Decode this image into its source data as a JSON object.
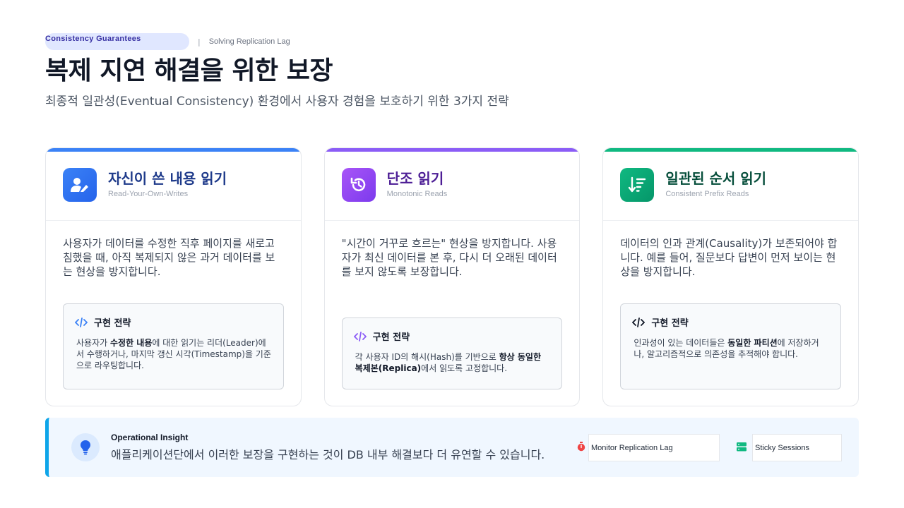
{
  "header": {
    "badge": "Consistency Guarantees",
    "separator": "|",
    "section": "Solving Replication Lag",
    "title": "복제 지연 해결을 위한 보장",
    "subtitle": "최종적 일관성(Eventual Consistency) 환경에서 사용자 경험을 보호하기 위한 3가지 전략"
  },
  "cards": [
    {
      "title": "자신이 쓴 내용 읽기",
      "subtitle_en": "Read-Your-Own-Writes",
      "icon": "user-edit-icon",
      "accent": "#3b82f6",
      "title_color": "#1e3a8a",
      "description": "사용자가 데이터를 수정한 직후 페이지를 새로고침했을 때, 아직 복제되지 않은 과거 데이터를 보는 현상을 방지합니다.",
      "strategy_label": "구현 전략",
      "strategy_pre": "사용자가 ",
      "strategy_bold1": "수정한 내용",
      "strategy_mid": "에 대한 읽기는 리더(Leader)에서 수행하거나, 마지막 갱신 시각(Timestamp)을 기준으로 라우팅합니다.",
      "strategy_bold2": "",
      "strategy_post": ""
    },
    {
      "title": "단조 읽기",
      "subtitle_en": "Monotonic Reads",
      "icon": "history-icon",
      "accent": "#8b5cf6",
      "title_color": "#4c1d95",
      "description": "\"시간이 거꾸로 흐르는\" 현상을 방지합니다. 사용자가 최신 데이터를 본 후, 다시 더 오래된 데이터를 보지 않도록 보장합니다.",
      "strategy_label": "구현 전략",
      "strategy_pre": "각 사용자 ID의 해시(Hash)를 기반으로 ",
      "strategy_bold1": "항상 동일한 복제본(Replica)",
      "strategy_mid": "에서 읽도록 고정합니다.",
      "strategy_bold2": "",
      "strategy_post": ""
    },
    {
      "title": "일관된 순서 읽기",
      "subtitle_en": "Consistent Prefix Reads",
      "icon": "sort-down-icon",
      "accent": "#10b981",
      "title_color": "#064e3b",
      "description": "데이터의 인과 관계(Causality)가 보존되어야 합니다. 예를 들어, 질문보다 답변이 먼저 보이는 현상을 방지합니다.",
      "strategy_label": "구현 전략",
      "strategy_pre": "인과성이 있는 데이터들은 ",
      "strategy_bold1": "동일한 파티션",
      "strategy_mid": "에 저장하거나, 알고리즘적으로 의존성을 추적해야 합니다.",
      "strategy_bold2": "",
      "strategy_post": ""
    }
  ],
  "insight": {
    "label": "Operational Insight",
    "text": "애플리케이션단에서 이러한 보장을 구현하는 것이 DB 내부 해결보다 더 유연할 수 있습니다.",
    "icon": "lightbulb-icon",
    "tags": [
      {
        "label": "Monitor Replication Lag",
        "icon": "stopwatch-icon",
        "color": "#ef4444"
      },
      {
        "label": "Sticky Sessions",
        "icon": "server-icon",
        "color": "#10b981"
      }
    ]
  }
}
